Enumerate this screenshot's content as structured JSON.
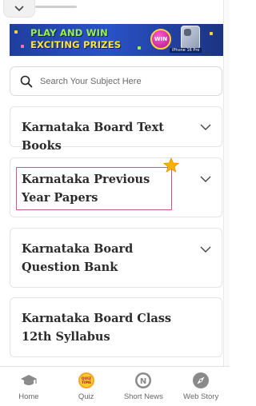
{
  "banner": {
    "line1": "PLAY AND WIN",
    "line2": "EXCITING PRIZES",
    "badge": "WIN",
    "prize": "iPhone 16 Pro"
  },
  "search": {
    "placeholder": "Search Your Subject Here"
  },
  "cards": [
    {
      "title": "Karnataka Board Text Books"
    },
    {
      "title": "Karnataka Previous Year Papers"
    },
    {
      "title": "Karnataka Board Question Bank"
    },
    {
      "title": "Karnataka Board Class 12th Syllabus"
    }
  ],
  "bottom_nav": {
    "items": [
      {
        "label": "Home",
        "icon": "graduation-cap-icon"
      },
      {
        "label": "Quiz",
        "icon": "quiz-time-icon",
        "badge": "QUIZ TIME"
      },
      {
        "label": "Short News",
        "icon": "news-n-icon",
        "glyph": "N"
      },
      {
        "label": "Web Story",
        "icon": "compass-icon"
      }
    ]
  },
  "colors": {
    "highlight_border": "#c25a8e",
    "star": "#f5b400",
    "banner_bg": "#2a52c9",
    "quiz_icon": "#f5a623"
  }
}
